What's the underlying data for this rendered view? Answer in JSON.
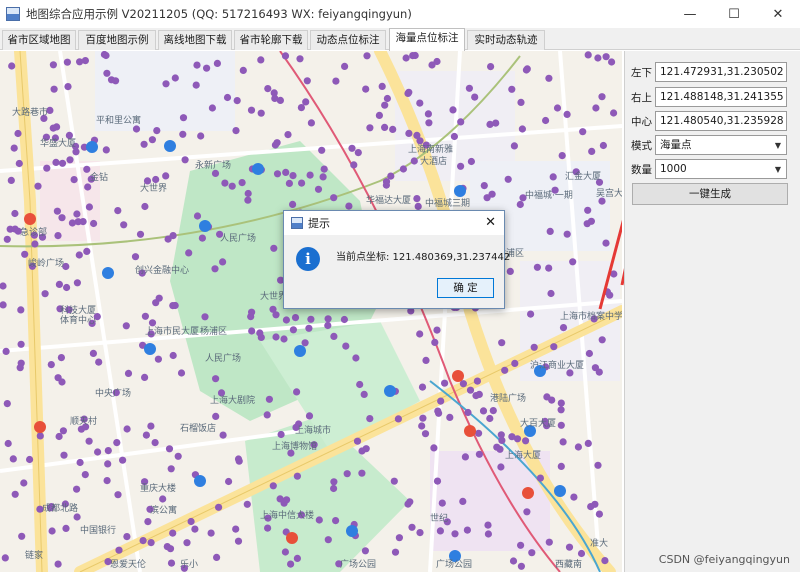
{
  "window": {
    "title": "地图综合应用示例 V20211205 (QQ: 517216493 WX: feiyangqingyun)",
    "buttons": [
      "—",
      "☐",
      "✕"
    ]
  },
  "tabs": [
    {
      "label": "省市区域地图",
      "active": false
    },
    {
      "label": "百度地图示例",
      "active": false
    },
    {
      "label": "离线地图下载",
      "active": false
    },
    {
      "label": "省市轮廓下载",
      "active": false
    },
    {
      "label": "动态点位标注",
      "active": false
    },
    {
      "label": "海量点位标注",
      "active": true
    },
    {
      "label": "实时动态轨迹",
      "active": false
    }
  ],
  "panel": {
    "left_bottom_label": "左下",
    "left_bottom_value": "121.472931,31.230502",
    "right_top_label": "右上",
    "right_top_value": "121.488148,31.241355",
    "center_label": "中心",
    "center_value": "121.480540,31.235928",
    "mode_label": "模式",
    "mode_value": "海量点",
    "count_label": "数量",
    "count_value": "1000",
    "generate_label": "一键生成"
  },
  "dialog": {
    "title": "提示",
    "message": "当前点坐标: 121.480369,31.237442",
    "ok_label": "确 定",
    "icon": "information-icon"
  },
  "map": {
    "labels": [
      {
        "text": "大路巷市"
      },
      {
        "text": "平和里公寓"
      },
      {
        "text": "华盛大厦"
      },
      {
        "text": "永新广场"
      },
      {
        "text": "上海南新雅"
      },
      {
        "text": "大酒店"
      },
      {
        "text": "华福达大厦"
      },
      {
        "text": "中福城三期"
      },
      {
        "text": "中福城·一期"
      },
      {
        "text": "汇金大厦"
      },
      {
        "text": "吴宫大"
      },
      {
        "text": "金钻"
      },
      {
        "text": "大世界"
      },
      {
        "text": "人民广场"
      },
      {
        "text": "民广场"
      },
      {
        "text": "上海市黄浦区"
      },
      {
        "text": "急诊部"
      },
      {
        "text": "峻岭广场"
      },
      {
        "text": "创兴金融中心"
      },
      {
        "text": "科技大厦"
      },
      {
        "text": "体育中心"
      },
      {
        "text": "上海市民大厦"
      },
      {
        "text": "杨浦区"
      },
      {
        "text": "沪江商业大厦"
      },
      {
        "text": "上海市档案中学"
      },
      {
        "text": "人民广场"
      },
      {
        "text": "上海大剧院"
      },
      {
        "text": "上海博物馆"
      },
      {
        "text": "上海城市"
      },
      {
        "text": "石榴饭店"
      },
      {
        "text": "顺天村"
      },
      {
        "text": "中央广场"
      },
      {
        "text": "重庆大楼"
      },
      {
        "text": "滨公寓"
      },
      {
        "text": "大世界"
      },
      {
        "text": "成都北路"
      },
      {
        "text": "中国银行"
      },
      {
        "text": "港陆广场"
      },
      {
        "text": "大百大厦"
      },
      {
        "text": "上海大厦"
      },
      {
        "text": "上海中信大楼"
      },
      {
        "text": "广场公园"
      },
      {
        "text": "广场公园"
      },
      {
        "text": "乐小"
      },
      {
        "text": "世纪"
      },
      {
        "text": "恩爱天伦"
      },
      {
        "text": "西藏南"
      },
      {
        "text": "准大"
      },
      {
        "text": "链家"
      }
    ]
  },
  "watermark": "CSDN @feiyangqingyun",
  "colors": {
    "marker": "#8e59b8",
    "park": "#bfe7c6",
    "road_major": "#fbe39a",
    "road_minor": "#ffffff",
    "accent_arrow": "#e53935",
    "info_blue": "#1a6fd0"
  }
}
